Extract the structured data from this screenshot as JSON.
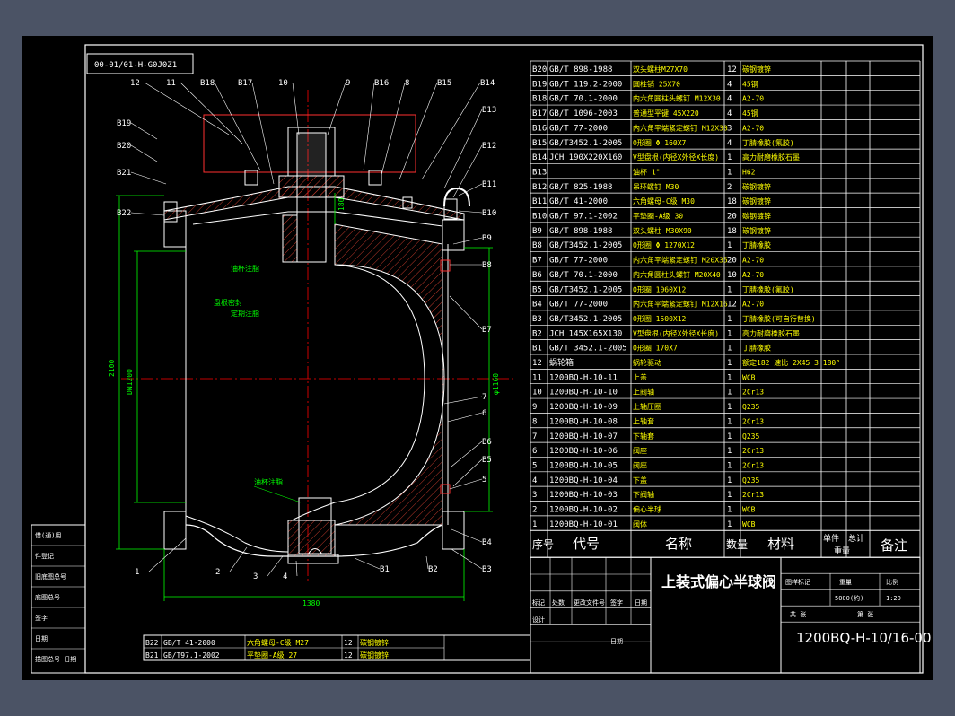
{
  "drawing": {
    "stamp": "00-01/01-H-G0J0Z1",
    "title": "上装式偏心半球阀",
    "number": "1200BQ-H-10/16-00",
    "scale": "1:20",
    "weight": "5000(约)",
    "sheet": "第 张",
    "sheets": "共 张",
    "dims": {
      "height": "2100",
      "bore": "DN1200",
      "flange_d": "φ1160",
      "face_to_face": "1380",
      "top": "180"
    }
  },
  "annotations": {
    "stem": "油杯注脂",
    "seal": "盘根密封",
    "bottom": "油杯注脂",
    "note2": "定期注脂"
  },
  "callouts_left": [
    "12",
    "11",
    "B18",
    "B17",
    "10",
    "B19",
    "B20",
    "B21",
    "B22",
    "1",
    "2",
    "3",
    "4"
  ],
  "callouts_right": [
    "9",
    "B16",
    "8",
    "B15",
    "B14",
    "B13",
    "B12",
    "B11",
    "B10",
    "B9",
    "B8",
    "B7",
    "7",
    "6",
    "B6",
    "B5",
    "5",
    "B4",
    "B3",
    "B2",
    "B1"
  ],
  "bom_header": {
    "no": "序号",
    "code": "代号",
    "name": "名称",
    "qty": "数量",
    "material": "材料",
    "unit_w": "单件",
    "total_w": "总计",
    "weight": "重量",
    "remark": "备注"
  },
  "bom": [
    {
      "no": "B20",
      "code": "GB/T 898-1988",
      "name": "双头螺柱M27X70",
      "qty": "12",
      "mat": "碳钢镀锌"
    },
    {
      "no": "B19",
      "code": "GB/T 119.2-2000",
      "name": "圆柱销 25X70",
      "qty": "4",
      "mat": "45钢"
    },
    {
      "no": "B18",
      "code": "GB/T 70.1-2000",
      "name": "内六角圆柱头螺钉 M12X30",
      "qty": "4",
      "mat": "A2-70"
    },
    {
      "no": "B17",
      "code": "GB/T 1096-2003",
      "name": "普通型平键 45X220",
      "qty": "4",
      "mat": "45钢"
    },
    {
      "no": "B16",
      "code": "GB/T 77-2000",
      "name": "内六角平端紧定螺钉 M12X30",
      "qty": "3",
      "mat": "A2-70"
    },
    {
      "no": "B15",
      "code": "GB/T3452.1-2005",
      "name": "O形圈 Φ 160X7",
      "qty": "4",
      "mat": "丁腈橡胶(氟胶)"
    },
    {
      "no": "B14",
      "code": "JCH 190X220X160",
      "name": "V型盘根(内径X外径X长度)",
      "qty": "1",
      "mat": "高力耐磨橡胶石墨"
    },
    {
      "no": "B13",
      "code": "",
      "name": "油杯 1\"",
      "qty": "1",
      "mat": "H62"
    },
    {
      "no": "B12",
      "code": "GB/T 825-1988",
      "name": "吊环螺钉 M30",
      "qty": "2",
      "mat": "碳钢镀锌"
    },
    {
      "no": "B11",
      "code": "GB/T 41-2000",
      "name": "六角螺母-C级 M30",
      "qty": "18",
      "mat": "碳钢镀锌"
    },
    {
      "no": "B10",
      "code": "GB/T 97.1-2002",
      "name": "平垫圈-A级 30",
      "qty": "20",
      "mat": "碳钢镀锌"
    },
    {
      "no": "B9",
      "code": "GB/T 898-1988",
      "name": "双头螺柱 M30X90",
      "qty": "18",
      "mat": "碳钢镀锌"
    },
    {
      "no": "B8",
      "code": "GB/T3452.1-2005",
      "name": "O形圈 Φ 1270X12",
      "qty": "1",
      "mat": "丁腈橡胶"
    },
    {
      "no": "B7",
      "code": "GB/T 77-2000",
      "name": "内六角平端紧定螺钉 M20X35",
      "qty": "20",
      "mat": "A2-70"
    },
    {
      "no": "B6",
      "code": "GB/T 70.1-2000",
      "name": "内六角圆柱头螺钉 M20X40",
      "qty": "10",
      "mat": "A2-70"
    },
    {
      "no": "B5",
      "code": "GB/T3452.1-2005",
      "name": "O形圈 1060X12",
      "qty": "1",
      "mat": "丁腈橡胶(氟胶)"
    },
    {
      "no": "B4",
      "code": "GB/T 77-2000",
      "name": "内六角平端紧定螺钉 M12X16",
      "qty": "12",
      "mat": "A2-70"
    },
    {
      "no": "B3",
      "code": "GB/T3452.1-2005",
      "name": "O形圈 1500X12",
      "qty": "1",
      "mat": "丁腈橡胶(可自行替换)"
    },
    {
      "no": "B2",
      "code": "JCH 145X165X130",
      "name": "V型盘根(内径X外径X长度)",
      "qty": "1",
      "mat": "高力耐磨橡胶石墨"
    },
    {
      "no": "B1",
      "code": "GB/T 3452.1-2005",
      "name": "O形圈 170X7",
      "qty": "1",
      "mat": "丁腈橡胶"
    },
    {
      "no": "12",
      "code": "蜗轮箱",
      "name": "蜗轮驱动",
      "qty": "1",
      "mat": "额定182 速比 2X45 3 180°"
    },
    {
      "no": "11",
      "code": "1200BQ-H-10-11",
      "name": "上盖",
      "qty": "1",
      "mat": "WCB"
    },
    {
      "no": "10",
      "code": "1200BQ-H-10-10",
      "name": "上阀轴",
      "qty": "1",
      "mat": "2Cr13"
    },
    {
      "no": "9",
      "code": "1200BQ-H-10-09",
      "name": "上轴压圈",
      "qty": "1",
      "mat": "Q235"
    },
    {
      "no": "8",
      "code": "1200BQ-H-10-08",
      "name": "上轴套",
      "qty": "1",
      "mat": "2Cr13"
    },
    {
      "no": "7",
      "code": "1200BQ-H-10-07",
      "name": "下轴套",
      "qty": "1",
      "mat": "Q235"
    },
    {
      "no": "6",
      "code": "1200BQ-H-10-06",
      "name": "阀座",
      "qty": "1",
      "mat": "2Cr13"
    },
    {
      "no": "5",
      "code": "1200BQ-H-10-05",
      "name": "阀座",
      "qty": "1",
      "mat": "2Cr13"
    },
    {
      "no": "4",
      "code": "1200BQ-H-10-04",
      "name": "下盖",
      "qty": "1",
      "mat": "Q235"
    },
    {
      "no": "3",
      "code": "1200BQ-H-10-03",
      "name": "下阀轴",
      "qty": "1",
      "mat": "2Cr13"
    },
    {
      "no": "2",
      "code": "1200BQ-H-10-02",
      "name": "偏心半球",
      "qty": "1",
      "mat": "WCB"
    },
    {
      "no": "1",
      "code": "1200BQ-H-10-01",
      "name": "阀体",
      "qty": "1",
      "mat": "WCB"
    }
  ],
  "bom_bottom": [
    {
      "no": "B22",
      "code": "GB/T 41-2000",
      "name": "六角螺母-C级 M27",
      "qty": "12",
      "mat": "碳钢镀锌"
    },
    {
      "no": "B21",
      "code": "GB/T97.1-2002",
      "name": "平垫圈-A级 27",
      "qty": "12",
      "mat": "碳钢镀锌"
    }
  ],
  "side_boxes": [
    "借(通)用",
    "件登记",
    "旧底图总号",
    "底图总号",
    "签字",
    "日期",
    "描图总号 日期"
  ],
  "title_block": {
    "marks": "标记",
    "count": "处数",
    "doc": "更改文件号",
    "sign": "签字",
    "date": "日期",
    "design": "设计",
    "stage_mark": "图样标记",
    "weight_lbl": "重量",
    "scale_lbl": "比例",
    "date2": "日期"
  },
  "colors": {
    "bg": "#4b5365",
    "sheet": "#000000",
    "line": "#ffffff",
    "center": "#ff0000",
    "dim": "#00ff00",
    "hatch": "#ff0000"
  }
}
